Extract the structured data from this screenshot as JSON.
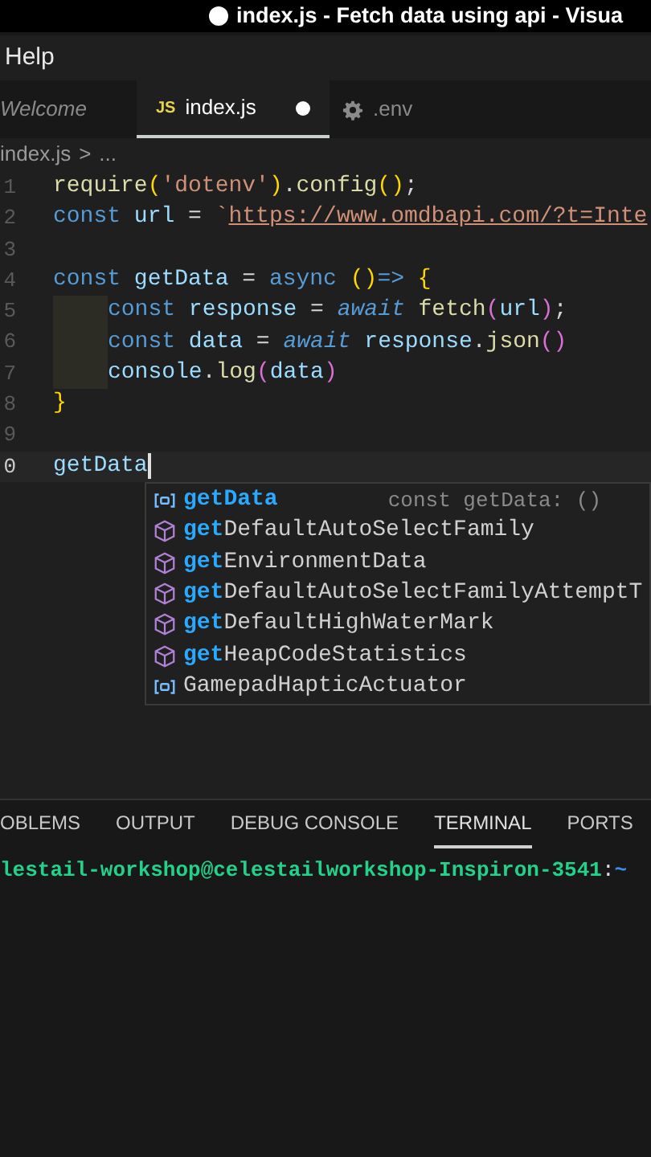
{
  "window": {
    "title": "index.js - Fetch data using api - Visua",
    "modified": true
  },
  "menu": [
    "Help"
  ],
  "tabs": [
    {
      "label": "Welcome",
      "kind": "preview",
      "selected": false,
      "modified": false
    },
    {
      "label": "index.js",
      "kind": "js",
      "icon_text": "JS",
      "selected": true,
      "modified": true
    },
    {
      "label": ".env",
      "kind": "settings",
      "selected": false,
      "modified": false
    }
  ],
  "breadcrumb": [
    "index.js",
    ">",
    "..."
  ],
  "editor": {
    "lines": [
      {
        "number": "1",
        "tokens": [
          {
            "text": "require",
            "kind": "function"
          },
          {
            "text": "(",
            "kind": "bracket1"
          },
          {
            "text": "'dotenv'",
            "kind": "string"
          },
          {
            "text": ")",
            "kind": "bracket1"
          },
          {
            "text": ".",
            "kind": "plain"
          },
          {
            "text": "config",
            "kind": "function"
          },
          {
            "text": "()",
            "kind": "bracket1"
          },
          {
            "text": ";",
            "kind": "plain"
          }
        ]
      },
      {
        "number": "2",
        "tokens": [
          {
            "text": "const",
            "kind": "keyword"
          },
          {
            "text": " url",
            "kind": "variable"
          },
          {
            "text": " = ",
            "kind": "plain"
          },
          {
            "text": "`",
            "kind": "string"
          },
          {
            "text": "https://www.omdbapi.com/?t=Inte",
            "kind": "link"
          }
        ]
      },
      {
        "number": "3"
      },
      {
        "number": "4",
        "tokens": [
          {
            "text": "const",
            "kind": "keyword"
          },
          {
            "text": " getData",
            "kind": "variable"
          },
          {
            "text": " = ",
            "kind": "plain"
          },
          {
            "text": "async ",
            "kind": "keyword"
          },
          {
            "text": "()",
            "kind": "bracket1"
          },
          {
            "text": "=>",
            "kind": "keyword"
          },
          {
            "text": " {",
            "kind": "bracket1"
          }
        ]
      },
      {
        "number": "5",
        "indent": true,
        "tokens": [
          {
            "text": "const",
            "kind": "keyword"
          },
          {
            "text": " response",
            "kind": "variable"
          },
          {
            "text": " = ",
            "kind": "plain"
          },
          {
            "text": "await ",
            "kind": "control"
          },
          {
            "text": "fetch",
            "kind": "function"
          },
          {
            "text": "(",
            "kind": "bracket2"
          },
          {
            "text": "url",
            "kind": "variable"
          },
          {
            "text": ")",
            "kind": "bracket2"
          },
          {
            "text": ";",
            "kind": "plain"
          }
        ]
      },
      {
        "number": "6",
        "indent": true,
        "tokens": [
          {
            "text": "const",
            "kind": "keyword"
          },
          {
            "text": " data",
            "kind": "variable"
          },
          {
            "text": " = ",
            "kind": "plain"
          },
          {
            "text": "await",
            "kind": "control"
          },
          {
            "text": " response",
            "kind": "variable"
          },
          {
            "text": ".",
            "kind": "plain"
          },
          {
            "text": "json",
            "kind": "function"
          },
          {
            "text": "()",
            "kind": "bracket2"
          }
        ]
      },
      {
        "number": "7",
        "indent": true,
        "tokens": [
          {
            "text": "console",
            "kind": "variable"
          },
          {
            "text": ".",
            "kind": "plain"
          },
          {
            "text": "log",
            "kind": "function"
          },
          {
            "text": "(",
            "kind": "bracket2"
          },
          {
            "text": "data",
            "kind": "variable"
          },
          {
            "text": ")",
            "kind": "bracket2"
          }
        ]
      },
      {
        "number": "8",
        "tokens": [
          {
            "text": "}",
            "kind": "bracket1"
          }
        ]
      },
      {
        "number": "9"
      },
      {
        "number": "0",
        "current": true,
        "tokens": [
          {
            "text": "getData",
            "kind": "variable"
          }
        ]
      }
    ]
  },
  "suggestions": {
    "detail": "const getData: ()",
    "items": [
      {
        "kind": "variable",
        "match": "getData"
      },
      {
        "kind": "module",
        "match": "get",
        "rest": "DefaultAutoSelectFamily"
      },
      {
        "kind": "module",
        "match": "get",
        "rest": "EnvironmentData"
      },
      {
        "kind": "module",
        "match": "get",
        "rest": "DefaultAutoSelectFamilyAttemptT"
      },
      {
        "kind": "module",
        "match": "get",
        "rest": "DefaultHighWaterMark"
      },
      {
        "kind": "module",
        "match": "get",
        "rest": "HeapCodeStatistics"
      },
      {
        "kind": "variable",
        "rest": "GamepadHapticActuator"
      }
    ]
  },
  "panel": {
    "tabs": [
      {
        "label": "OBLEMS",
        "selected": false
      },
      {
        "label": "OUTPUT",
        "selected": false
      },
      {
        "label": "DEBUG CONSOLE",
        "selected": false
      },
      {
        "label": "TERMINAL",
        "selected": true
      },
      {
        "label": "PORTS",
        "selected": false
      }
    ],
    "terminal": [
      {
        "text": "lestail-workshop@celestailworkshop-Inspiron-3541",
        "kind": "host"
      },
      {
        "text": ":",
        "kind": "plain"
      },
      {
        "text": "~",
        "kind": "path"
      }
    ]
  }
}
